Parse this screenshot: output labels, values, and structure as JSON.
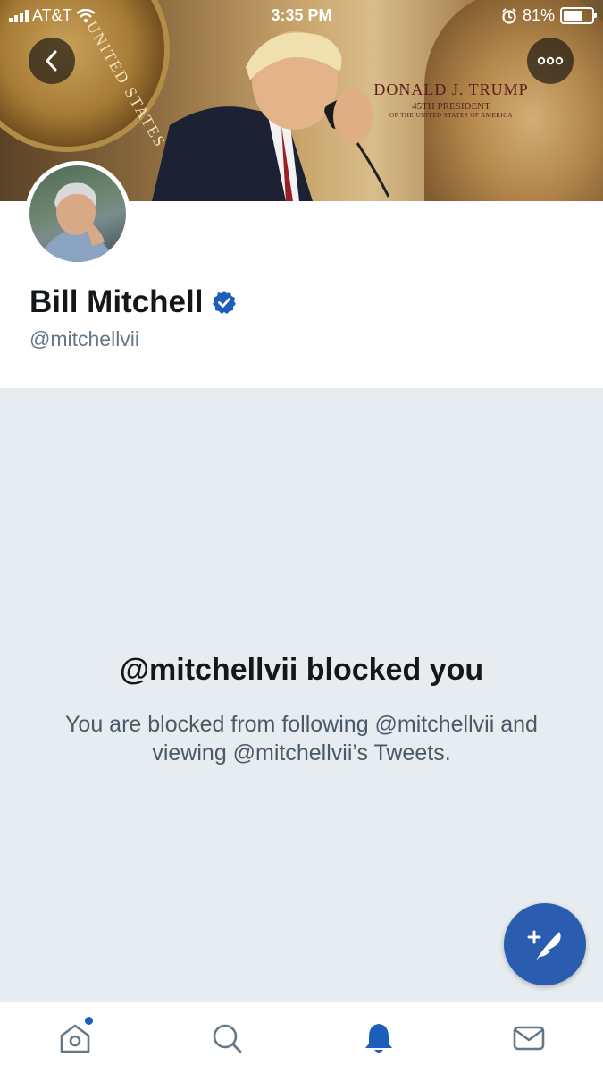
{
  "status_bar": {
    "carrier": "AT&T",
    "time": "3:35 PM",
    "battery_percent": "81%",
    "battery_level": 0.81,
    "icons": [
      "signal-icon",
      "wifi-icon",
      "alarm-icon",
      "battery-icon"
    ]
  },
  "banner": {
    "seal_text": "UNITED STATES",
    "title": "DONALD J. TRUMP",
    "subtitle": "45TH PRESIDENT",
    "subtitle2": "OF THE UNITED STATES OF AMERICA"
  },
  "header_buttons": {
    "back_icon": "chevron-left-icon",
    "more_icon": "more-horizontal-icon"
  },
  "profile": {
    "name": "Bill Mitchell",
    "verified": true,
    "handle": "@mitchellvii"
  },
  "blocked": {
    "title": "@mitchellvii blocked you",
    "message": "You are blocked from following @mitchellvii and viewing @mitchellvii’s Tweets."
  },
  "fab": {
    "icon": "compose-tweet-icon"
  },
  "tabbar": {
    "tabs": [
      {
        "icon": "home-icon",
        "has_notification_dot": true
      },
      {
        "icon": "search-icon"
      },
      {
        "icon": "bell-icon",
        "active": true
      },
      {
        "icon": "mail-icon"
      }
    ]
  },
  "colors": {
    "accent": "#1c5fb8",
    "fab": "#2a5db0",
    "blocked_bg": "#e6ecf0",
    "secondary_text": "#657786"
  }
}
